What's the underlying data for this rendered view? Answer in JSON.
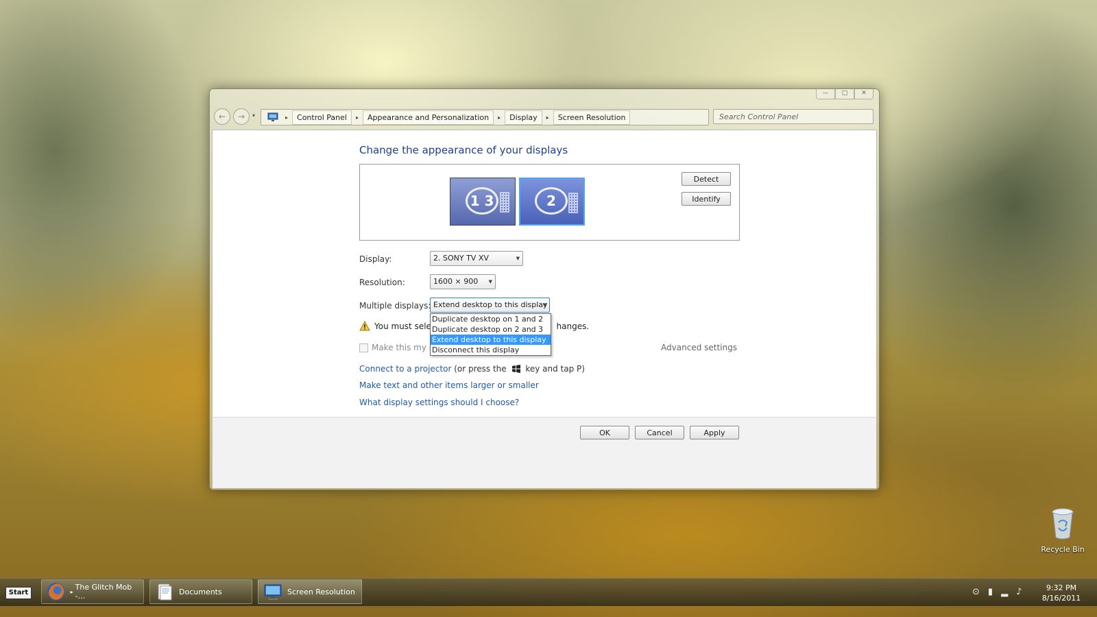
{
  "window": {
    "controls": {
      "minimize": "—",
      "maximize": "□",
      "close": "✕"
    }
  },
  "nav": {
    "back_icon": "←",
    "forward_icon": "→",
    "history_icon": "▾",
    "crumbs": [
      "Control Panel",
      "Appearance and Personalization",
      "Display",
      "Screen Resolution"
    ],
    "search_placeholder": "Search Control Panel"
  },
  "main": {
    "heading": "Change the appearance of your displays",
    "monitors": [
      {
        "label": "1 3"
      },
      {
        "label": "2"
      }
    ],
    "detect_label": "Detect",
    "identify_label": "Identify",
    "display_label": "Display:",
    "display_value": "2. SONY TV XV",
    "resolution_label": "Resolution:",
    "resolution_value": "1600 × 900",
    "multiple_label": "Multiple displays:",
    "multiple_value": "Extend desktop to this display",
    "multiple_options": [
      "Duplicate desktop on 1 and 2",
      "Duplicate desktop on 2 and 3",
      "Extend desktop to this display",
      "Disconnect this display"
    ],
    "warning_prefix": "You must selec",
    "warning_suffix": "hanges.",
    "main_display_checkbox": "Make this my ma",
    "advanced_settings": "Advanced settings",
    "projector_link": "Connect to a projector",
    "projector_hint_before": "(or press the",
    "projector_hint_after": "key and tap P)",
    "text_size_link": "Make text and other items larger or smaller",
    "help_link": "What display settings should I choose?",
    "ok_label": "OK",
    "cancel_label": "Cancel",
    "apply_label": "Apply"
  },
  "desktop": {
    "recycle_bin": "Recycle Bin"
  },
  "taskbar": {
    "start_label": "Start",
    "tasks": [
      "The Glitch Mob -...",
      "Documents",
      "Screen Resolution"
    ],
    "time": "9:32 PM",
    "date": "8/16/2011"
  }
}
